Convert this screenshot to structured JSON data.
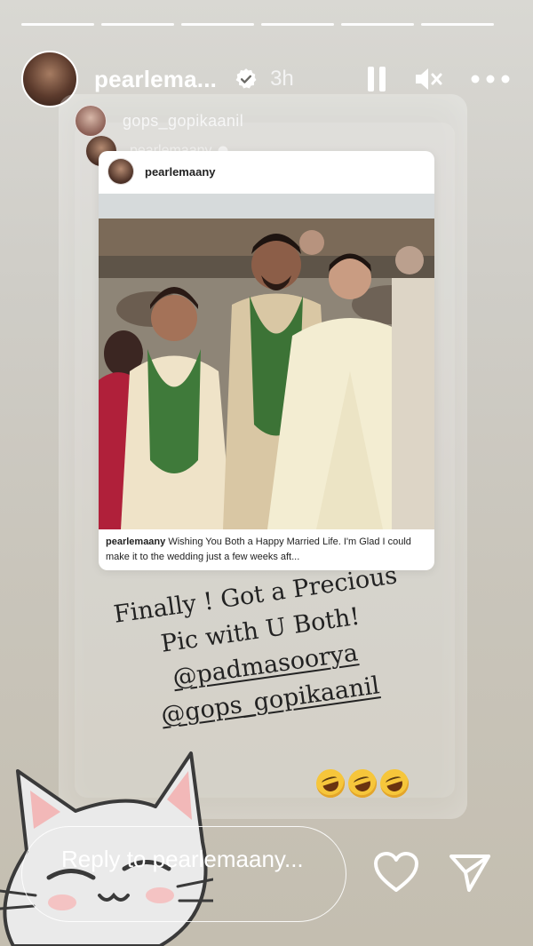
{
  "story": {
    "segments": 6,
    "username": "pearlema...",
    "time": "3h"
  },
  "mention1": {
    "username": "gops_gopikaanil"
  },
  "mention2": {
    "username": "pearlemaany"
  },
  "post": {
    "username": "pearlemaany",
    "caption_user": "pearlemaany",
    "caption_text": "Wishing You Both a Happy Married Life. I'm Glad I could make it to the wedding just a few weeks aft..."
  },
  "handwriting": {
    "line1": "Finally ! Got a Precious",
    "line2": "Pic with U Both!",
    "line3": "@padmasoorya",
    "line4": "@gops_gopikaanil"
  },
  "reply": {
    "placeholder": "Reply to pearlemaany..."
  },
  "icons": {
    "pause": "pause-icon",
    "mute": "mute-icon",
    "more": "more-icon",
    "heart": "heart-icon",
    "send": "send-icon",
    "verified": "verified-icon"
  },
  "colors": {
    "text": "#ffffff",
    "emoji": "#f6c63b"
  }
}
